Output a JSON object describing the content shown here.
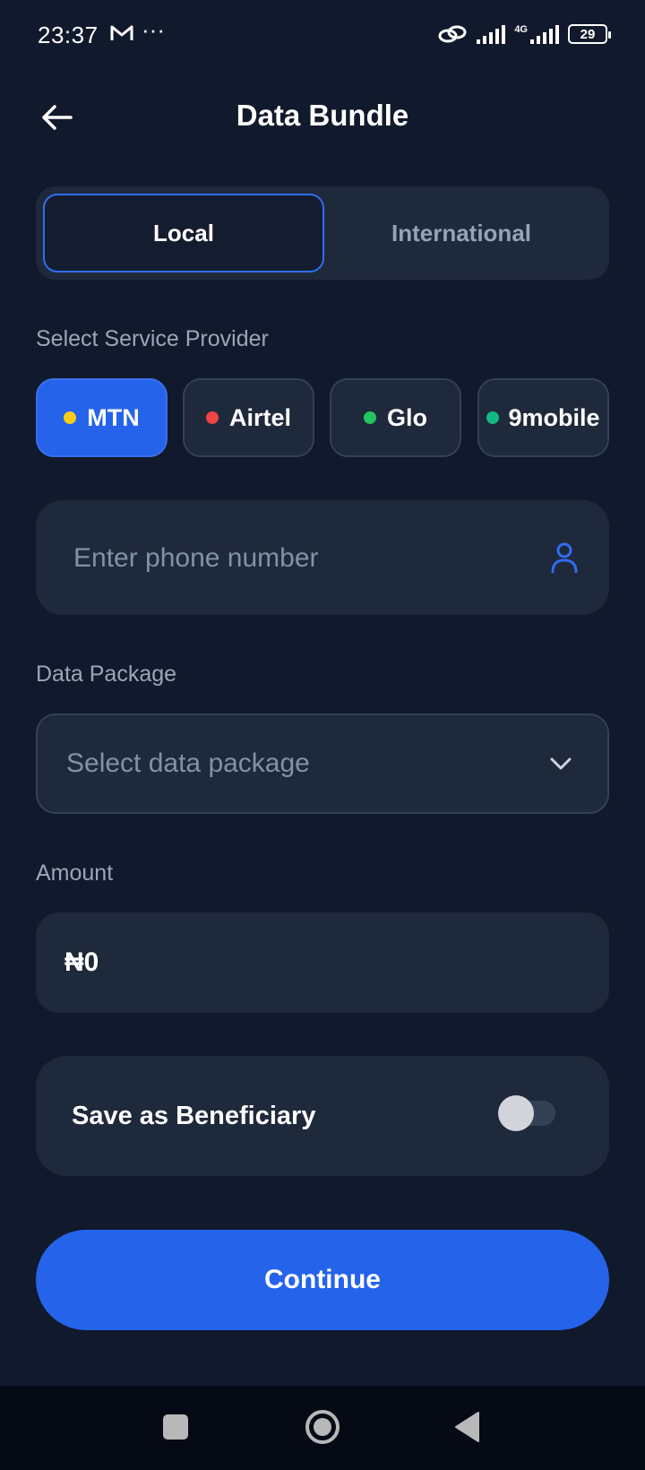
{
  "status_bar": {
    "time": "23:37",
    "more": "···",
    "network_type": "4G",
    "battery": "29"
  },
  "header": {
    "title": "Data Bundle"
  },
  "tabs": [
    {
      "label": "Local",
      "active": true
    },
    {
      "label": "International",
      "active": false
    }
  ],
  "provider_section": {
    "label": "Select Service Provider",
    "providers": [
      {
        "name": "MTN",
        "dot_color": "#facc15",
        "selected": true
      },
      {
        "name": "Airtel",
        "dot_color": "#ef4444",
        "selected": false
      },
      {
        "name": "Glo",
        "dot_color": "#22c55e",
        "selected": false
      },
      {
        "name": "9mobile",
        "dot_color": "#10b981",
        "selected": false
      }
    ]
  },
  "phone": {
    "placeholder": "Enter phone number",
    "value": "",
    "icon": "contact-person-icon"
  },
  "package": {
    "label": "Data Package",
    "placeholder": "Select data package",
    "icon": "chevron-down-icon"
  },
  "amount": {
    "label": "Amount",
    "value": "₦0"
  },
  "beneficiary": {
    "label": "Save as Beneficiary",
    "enabled": false
  },
  "actions": {
    "continue_label": "Continue"
  },
  "nav_bar": {
    "icons": [
      "recents-square-icon",
      "home-circle-icon",
      "back-triangle-icon"
    ]
  },
  "colors": {
    "background": "#111a2c",
    "card": "#1e293b",
    "accent": "#2563eb",
    "muted_text": "#9aa6b8"
  }
}
